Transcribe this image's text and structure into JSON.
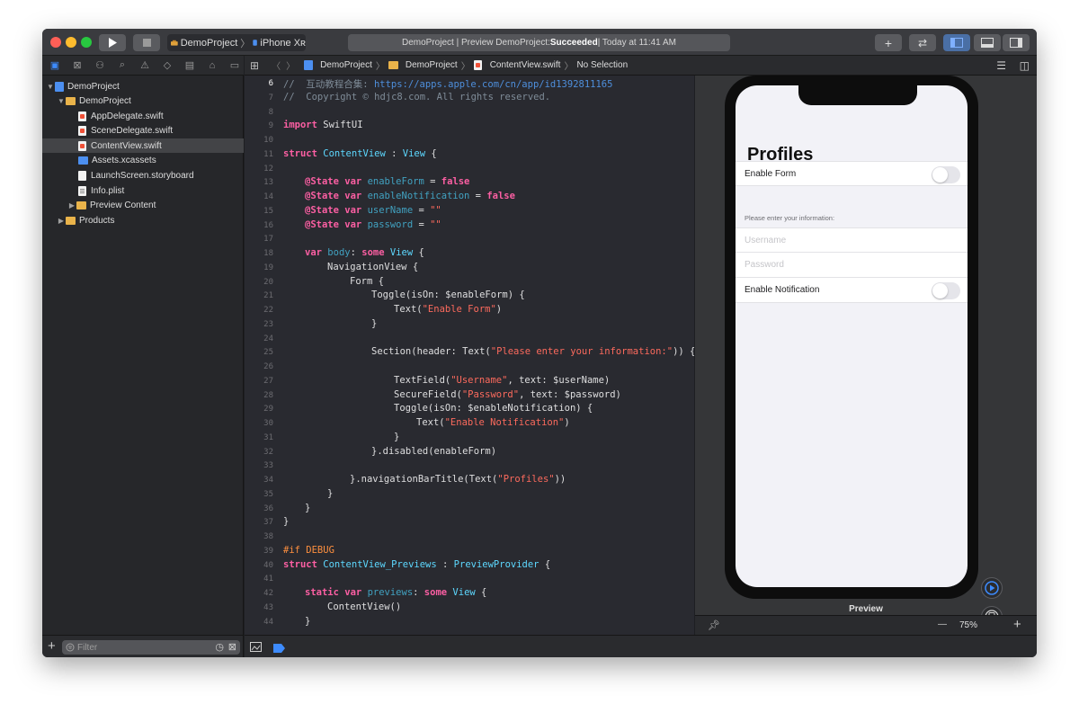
{
  "window": {
    "scheme_project": "DemoProject",
    "scheme_device": "iPhone Xʀ",
    "activity_prefix": "DemoProject | Preview DemoProject: ",
    "activity_status": "Succeeded",
    "activity_suffix": " | Today at 11:41 AM"
  },
  "navigator": {
    "items": [
      {
        "label": "DemoProject",
        "icon": "project-icon"
      },
      {
        "label": "DemoProject",
        "icon": "folder-icon"
      },
      {
        "label": "AppDelegate.swift",
        "icon": "swift-file-icon"
      },
      {
        "label": "SceneDelegate.swift",
        "icon": "swift-file-icon"
      },
      {
        "label": "ContentView.swift",
        "icon": "swift-file-icon",
        "selected": true
      },
      {
        "label": "Assets.xcassets",
        "icon": "assets-folder-icon"
      },
      {
        "label": "LaunchScreen.storyboard",
        "icon": "storyboard-file-icon"
      },
      {
        "label": "Info.plist",
        "icon": "plist-file-icon"
      },
      {
        "label": "Preview Content",
        "icon": "folder-icon"
      },
      {
        "label": "Products",
        "icon": "folder-icon"
      }
    ],
    "filter_placeholder": "Filter"
  },
  "jumpbar": {
    "crumbs": [
      "DemoProject",
      "DemoProject",
      "ContentView.swift",
      "No Selection"
    ]
  },
  "code": {
    "line_numbers": [
      "6",
      "7",
      "8",
      "9",
      "10",
      "11",
      "12",
      "13",
      "14",
      "15",
      "16",
      "17",
      "18",
      "19",
      "20",
      "21",
      "22",
      "23",
      "24",
      "25",
      "26",
      "27",
      "28",
      "29",
      "30",
      "31",
      "32",
      "33",
      "34",
      "35",
      "36",
      "37",
      "38",
      "39",
      "40",
      "41",
      "42",
      "43",
      "44"
    ],
    "comment1_prefix": "//  互动教程合集: ",
    "comment1_url": "https://apps.apple.com/cn/app/id1392811165",
    "comment2": "//  Copyright © hdjc8.com. All rights reserved.",
    "kw_import": "import",
    "mod_swiftui": " SwiftUI",
    "kw_struct": "struct",
    "type_contentview": "ContentView",
    "colon": " : ",
    "type_view": "View",
    "open_brace": " {",
    "attr_state": "@State",
    "kw_var": "var",
    "prop_enableForm": "enableForm",
    "prop_enableNotification": "enableNotification",
    "prop_userName": "userName",
    "prop_password": "password",
    "eq": " = ",
    "kw_false": "false",
    "empty_str": "\"\"",
    "prop_body": "body",
    "colon_plain": ": ",
    "kw_some": "some",
    "navview": "NavigationView {",
    "form": "Form {",
    "toggle_enableForm": "Toggle(isOn: $enableForm) {",
    "text_open": "Text(",
    "str_enableForm": "\"Enable Form\"",
    "close_paren": ")",
    "close_brace": "}",
    "section_open": "Section(header: Text(",
    "str_header": "\"Please enter your information:\"",
    "section_close": ")) {",
    "textfield_open": "TextField(",
    "str_username": "\"Username\"",
    "textfield_close": ", text: $userName)",
    "securefield_open": "SecureField(",
    "str_password": "\"Password\"",
    "securefield_close": ", text: $password)",
    "toggle_enableNotification": "Toggle(isOn: $enableNotification) {",
    "str_enableNotification": "\"Enable Notification\"",
    "disabled": "}.disabled(enableForm)",
    "navtitle_open": "}.navigationBarTitle(Text(",
    "str_profiles": "\"Profiles\"",
    "navtitle_close": "))",
    "pp_if": "#if DEBUG",
    "type_previews": "ContentView_Previews",
    "type_previewprovider": "PreviewProvider",
    "kw_static": "static",
    "prop_previews": "previews",
    "contentview_call": "ContentView()"
  },
  "preview": {
    "title": "Profiles",
    "enable_form": "Enable Form",
    "section_header": "Please enter your information:",
    "username_placeholder": "Username",
    "password_placeholder": "Password",
    "enable_notification": "Enable Notification",
    "label": "Preview",
    "zoom": "75%",
    "zoom_out": "—",
    "zoom_in": "+"
  }
}
